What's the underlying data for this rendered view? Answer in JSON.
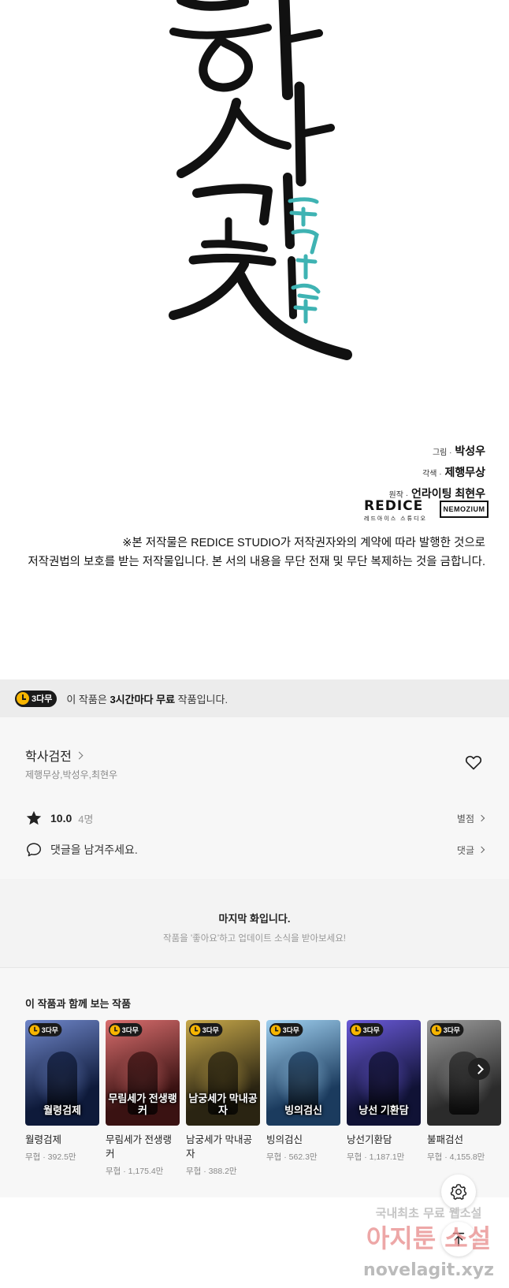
{
  "artwork": {
    "credits": [
      {
        "role": "그림 ·",
        "name": "박성우"
      },
      {
        "role": "각색 ·",
        "name": "제행무상"
      },
      {
        "role": "원작 ·",
        "name": "언라이팅 최현우"
      }
    ],
    "logo_left": "REDICE",
    "logo_left_sub": "레드아이스 스튜디오",
    "logo_right": "NEMOZIUM",
    "notice_line1": "※본 저작물은 REDICE STUDIO가 저작권자와의 계약에 따라 발행한 것으로",
    "notice_line2": "저작권법의 보호를 받는 저작물입니다. 본 서의 내용을 무단 전재 및 무단 복제하는 것을 금합니다."
  },
  "banner": {
    "badge": "3다무",
    "text_pre": "이 작품은 ",
    "text_bold": "3시간마다 무료",
    "text_post": " 작품입니다."
  },
  "work": {
    "title": "학사검전",
    "authors": "제행무상,박성우,최현우",
    "score": "10.0",
    "rating_count": "4명",
    "rating_link": "별점",
    "comment_prompt": "댓글을 남겨주세요.",
    "comment_link": "댓글"
  },
  "last_episode": {
    "title": "마지막 화입니다.",
    "subtitle": "작품을 '좋아요'하고 업데이트 소식을 받아보세요!"
  },
  "recommendations": {
    "heading": "이 작품과 함께 보는 작품",
    "badge": "3다무",
    "items": [
      {
        "name": "월령검제",
        "meta": "무협 · 392.5만",
        "cover": "월령검제",
        "color1": "#0e1a3a",
        "color2": "#6f86c9"
      },
      {
        "name": "무림세가 전생랭커",
        "meta": "무협 · 1,175.4만",
        "cover": "무림세가 전생랭커",
        "color1": "#3a1212",
        "color2": "#d96e6e"
      },
      {
        "name": "남궁세가 막내공자",
        "meta": "무협 · 388.2만",
        "cover": "남궁세가 막내공자",
        "color1": "#2a2412",
        "color2": "#c7a84a"
      },
      {
        "name": "빙의검신",
        "meta": "무협 · 562.3만",
        "cover": "빙의검신",
        "color1": "#1b3b5e",
        "color2": "#9fd0f0"
      },
      {
        "name": "낭선기환담",
        "meta": "무협 · 1,187.1만",
        "cover": "낭선 기환담",
        "color1": "#101235",
        "color2": "#6a5ad8"
      },
      {
        "name": "불패검선",
        "meta": "무협 · 4,155.8만",
        "cover": "",
        "color1": "#2b2b2b",
        "color2": "#9a9a9a"
      }
    ]
  },
  "watermark": {
    "line1": "국내최초 무료 웹소설",
    "line2": "아지툰 소설",
    "line3": "novelagit.xyz"
  },
  "colors": {
    "badge_clock": "#f7b500",
    "banner_bg": "#ececec",
    "card_bg": "#f7f7f7",
    "title_teal": "#3fb3b3"
  },
  "icons": [
    "heart-icon",
    "star-icon",
    "comment-icon",
    "chevron-right-icon",
    "clock-icon",
    "settings-icon",
    "arrow-up-icon"
  ]
}
